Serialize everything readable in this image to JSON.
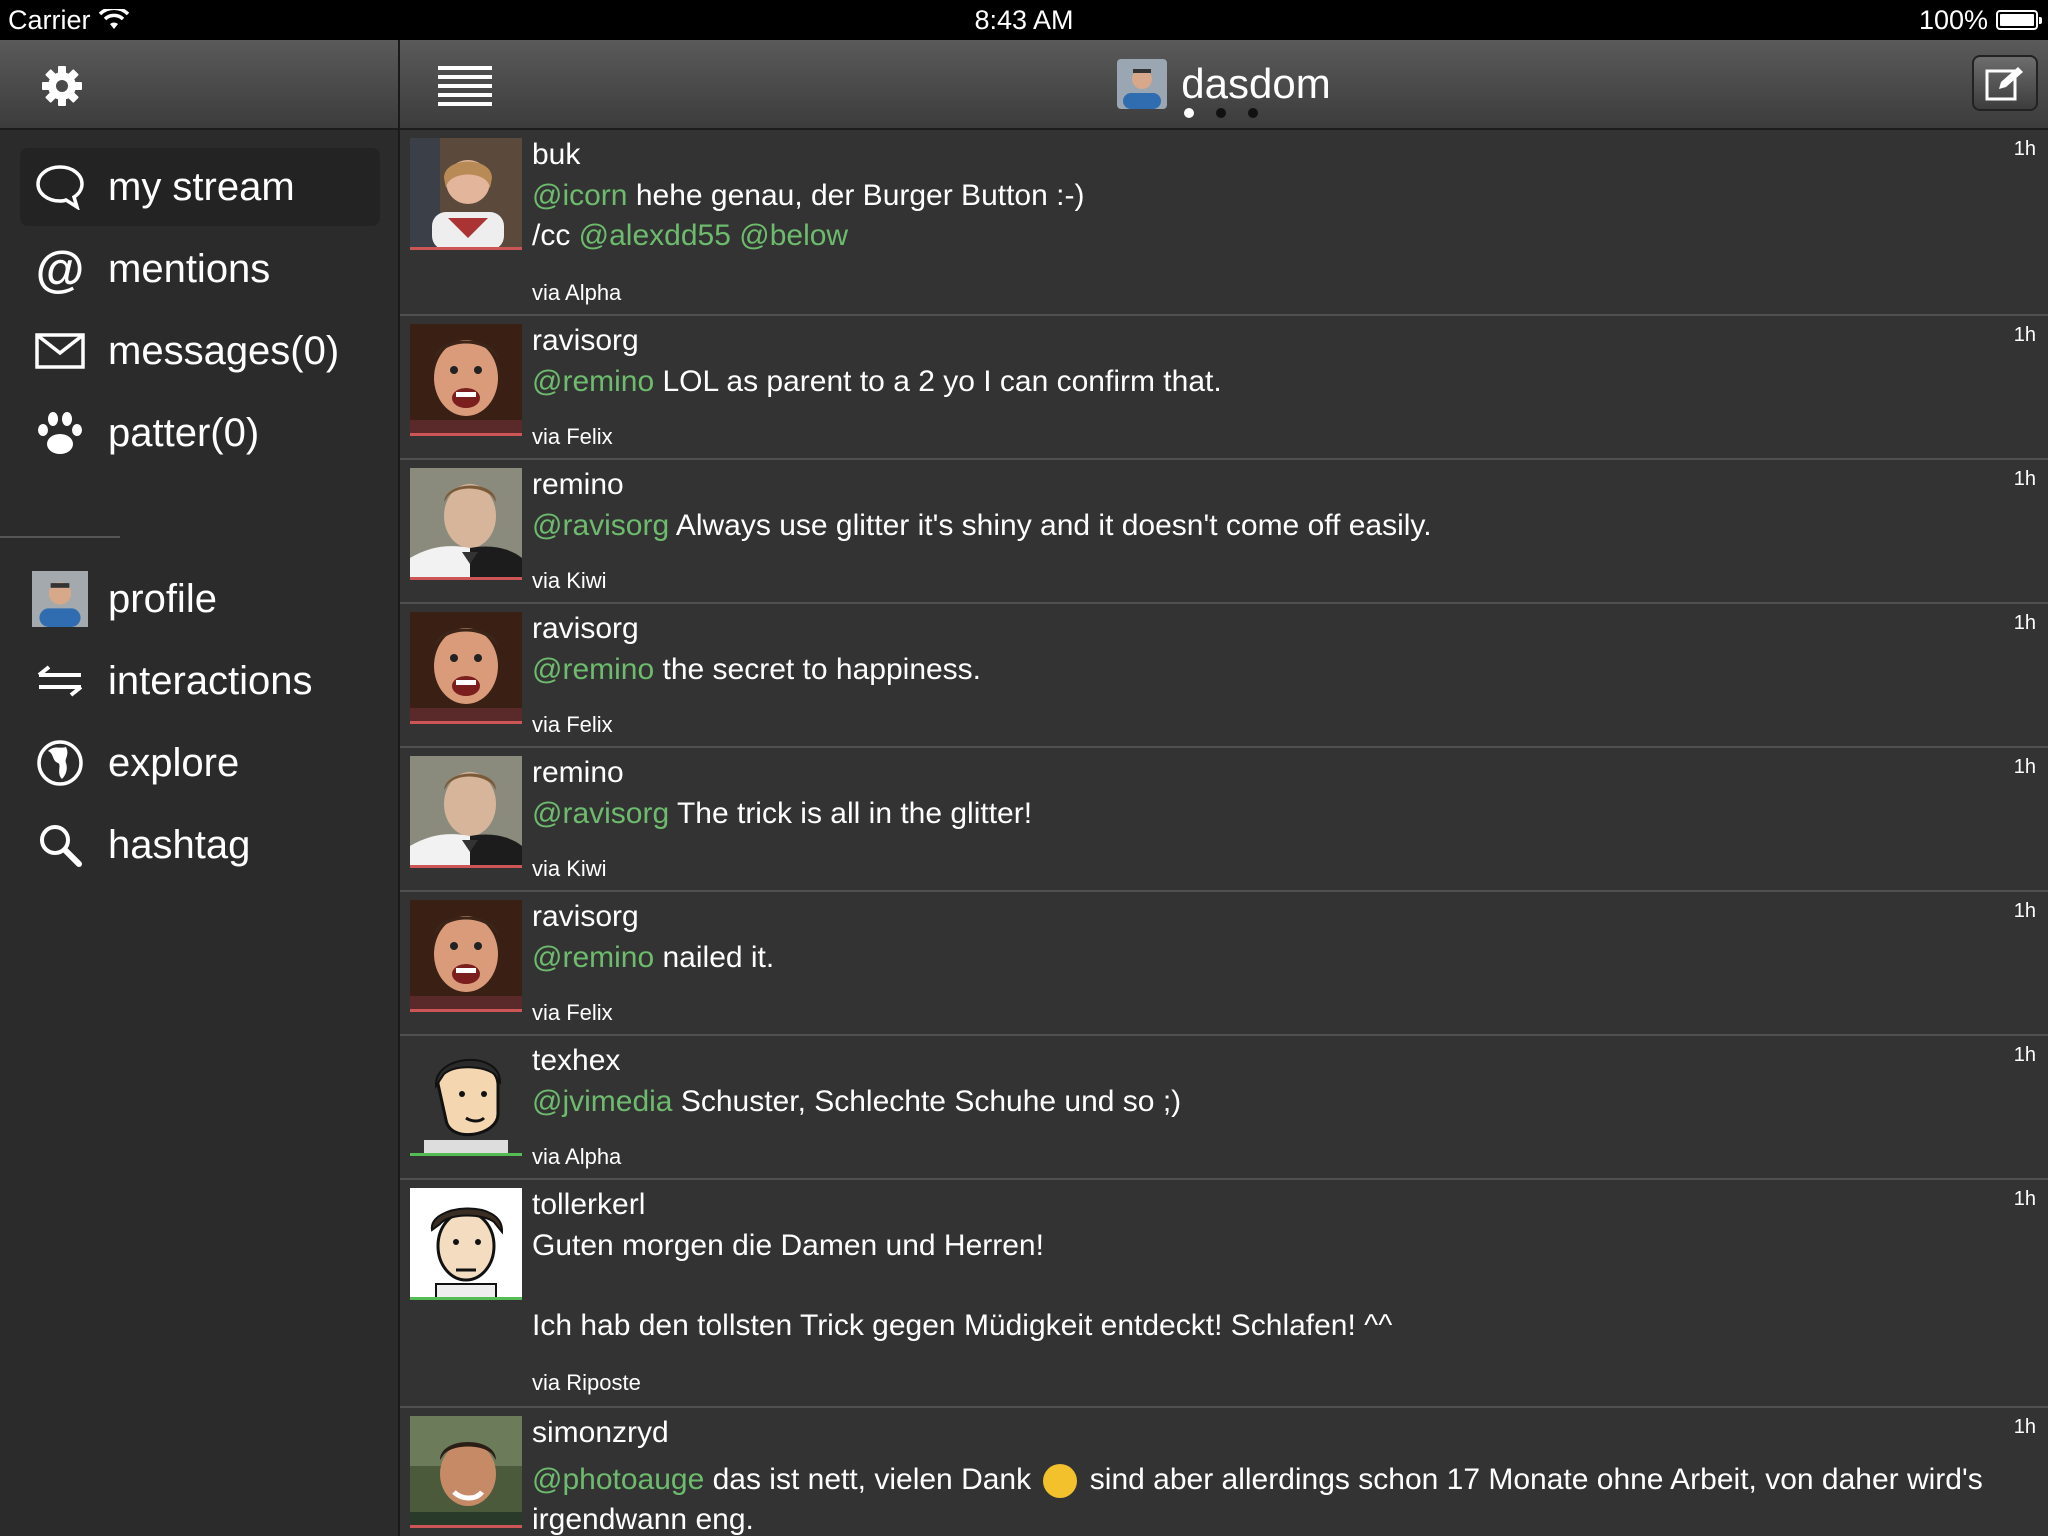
{
  "status_bar": {
    "carrier": "Carrier",
    "time": "8:43 AM",
    "battery": "100%"
  },
  "sidebar": {
    "items": [
      {
        "label": "my stream",
        "icon": "speech-bubble-icon"
      },
      {
        "label": "mentions",
        "icon": "at-sign-icon"
      },
      {
        "label": "messages(0)",
        "icon": "envelope-icon"
      },
      {
        "label": "patter(0)",
        "icon": "paw-icon"
      },
      {
        "label": "profile",
        "icon": "avatar"
      },
      {
        "label": "interactions",
        "icon": "arrows-icon"
      },
      {
        "label": "explore",
        "icon": "globe-icon"
      },
      {
        "label": "hashtag",
        "icon": "search-icon"
      }
    ]
  },
  "header": {
    "title": "dasdom"
  },
  "posts": [
    {
      "user": "buk",
      "time": "1h",
      "via": "via Alpha",
      "line1_mention": "@icorn",
      "line1_text": " hehe genau, der Burger Button :-)",
      "line2_prefix": "/cc ",
      "line2_mention1": "@alexdd55",
      "line2_mention2": "@below"
    },
    {
      "user": "ravisorg",
      "time": "1h",
      "via": "via Felix",
      "mention": "@remino",
      "text": " LOL as parent to a 2 yo I can confirm that."
    },
    {
      "user": "remino",
      "time": "1h",
      "via": "via Kiwi",
      "mention": "@ravisorg",
      "text": " Always use glitter it's shiny and it doesn't come off easily."
    },
    {
      "user": "ravisorg",
      "time": "1h",
      "via": "via Felix",
      "mention": "@remino",
      "text": " the secret to happiness."
    },
    {
      "user": "remino",
      "time": "1h",
      "via": "via Kiwi",
      "mention": "@ravisorg",
      "text": " The trick is all in the glitter!"
    },
    {
      "user": "ravisorg",
      "time": "1h",
      "via": "via Felix",
      "mention": "@remino",
      "text": " nailed it."
    },
    {
      "user": "texhex",
      "time": "1h",
      "via": "via Alpha",
      "mention": "@jvimedia",
      "text": " Schuster, Schlechte Schuhe und so ;)"
    },
    {
      "user": "tollerkerl",
      "time": "1h",
      "via": "via Riposte",
      "text1": "Guten morgen die Damen und Herren!",
      "text2": "Ich hab den tollsten Trick gegen Müdigkeit entdeckt! Schlafen! ^^"
    },
    {
      "user": "simonzryd",
      "time": "1h",
      "mention": "@photoauge",
      "text_a": " das ist nett, vielen Dank ",
      "emoji": "grinning-emoji",
      "text_b": " sind aber allerdings schon 17 Monate ohne Arbeit, von daher wird's",
      "text_c": "irgendwann eng."
    }
  ],
  "colors": {
    "mention": "#6dbb6d",
    "background": "#333333",
    "sidebar": "#2b2b2b"
  }
}
